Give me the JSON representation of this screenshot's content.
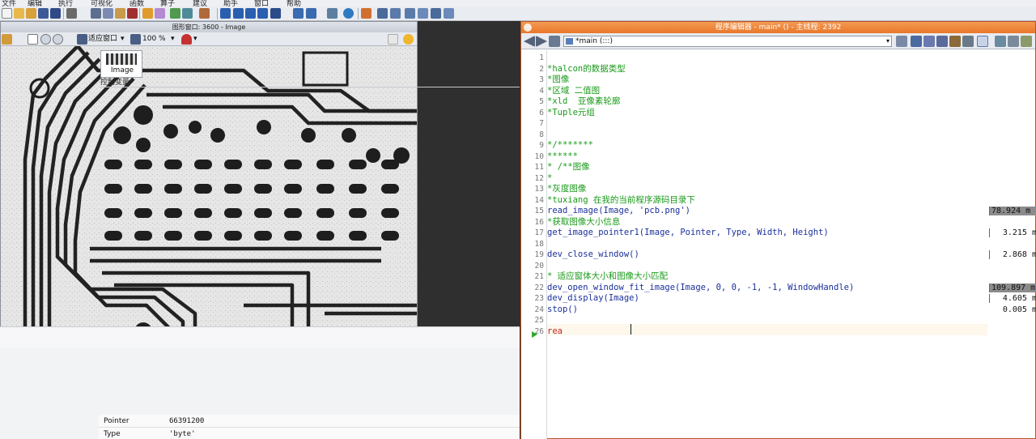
{
  "menubar": {
    "items": [
      "文件",
      "编辑",
      "执行",
      "可视化",
      "函数",
      "算子",
      "建议",
      "助手",
      "窗口",
      "帮助"
    ]
  },
  "graphics_window": {
    "title": "图形窗口: 3600 - Image",
    "fit_label": "适应窗口",
    "zoom_label": "100 %"
  },
  "variable_window": {
    "iconic_var_name": "Image",
    "control_header": "控制变量",
    "control_vars": [
      {
        "name": "Pointer",
        "value": "66391200"
      },
      {
        "name": "Type",
        "value": "'byte'"
      }
    ]
  },
  "editor": {
    "title": "程序编辑器 - main* () - 主线程: 2392",
    "procedure": "*main (:::)",
    "lines": [
      {
        "n": "1",
        "text": "",
        "kind": "comment"
      },
      {
        "n": "2",
        "text": "*halcon的数据类型",
        "kind": "comment"
      },
      {
        "n": "3",
        "text": "*图像",
        "kind": "comment"
      },
      {
        "n": "4",
        "text": "*区域 二值图",
        "kind": "comment"
      },
      {
        "n": "5",
        "text": "*xld  亚像素轮廓",
        "kind": "comment"
      },
      {
        "n": "6",
        "text": "*Tuple元组",
        "kind": "comment"
      },
      {
        "n": "7",
        "text": "",
        "kind": "comment"
      },
      {
        "n": "8",
        "text": "",
        "kind": "comment"
      },
      {
        "n": "9",
        "text": "*/*******",
        "kind": "comment"
      },
      {
        "n": "10",
        "text": "******",
        "kind": "comment"
      },
      {
        "n": "11",
        "text": "* /**图像",
        "kind": "comment"
      },
      {
        "n": "12",
        "text": "*",
        "kind": "comment"
      },
      {
        "n": "13",
        "text": "*灰度图像",
        "kind": "comment"
      },
      {
        "n": "14",
        "text": "*tuxiang 在我的当前程序源码目录下",
        "kind": "comment"
      },
      {
        "n": "15",
        "text": "read_image(Image, 'pcb.png')",
        "kind": "op"
      },
      {
        "n": "16",
        "text": "*获取图像大小信息",
        "kind": "comment"
      },
      {
        "n": "17",
        "text": "get_image_pointer1(Image, Pointer, Type, Width, Height)",
        "kind": "op"
      },
      {
        "n": "18",
        "text": "",
        "kind": "op"
      },
      {
        "n": "19",
        "text": "dev_close_window()",
        "kind": "op"
      },
      {
        "n": "20",
        "text": "",
        "kind": "op"
      },
      {
        "n": "21",
        "text": "* 适应窗体大小和图像大小匹配",
        "kind": "comment"
      },
      {
        "n": "22",
        "text": "dev_open_window_fit_image(Image, 0, 0, -1, -1, WindowHandle)",
        "kind": "op"
      },
      {
        "n": "23",
        "text": "dev_display(Image)",
        "kind": "op"
      },
      {
        "n": "24",
        "text": "stop()",
        "kind": "op"
      },
      {
        "n": "25",
        "text": "",
        "kind": "op"
      },
      {
        "n": "26",
        "text": "rea",
        "kind": "typing"
      }
    ],
    "runtimes": [
      {
        "line": 15,
        "value": "78.924 m",
        "highlight": true
      },
      {
        "line": 17,
        "value": "3.215 m",
        "highlight": false
      },
      {
        "line": 19,
        "value": "2.868 m",
        "highlight": false
      },
      {
        "line": 22,
        "value": "109.897 m",
        "highlight": true
      },
      {
        "line": 23,
        "value": "4.605 m",
        "highlight": false
      },
      {
        "line": 24,
        "value": "0.005 m",
        "highlight": false
      }
    ]
  },
  "colors": {
    "editor_title": "#e9772a",
    "comment": "#1a9a1a",
    "operator": "#1a2f9a",
    "typing": "#c2261d"
  }
}
